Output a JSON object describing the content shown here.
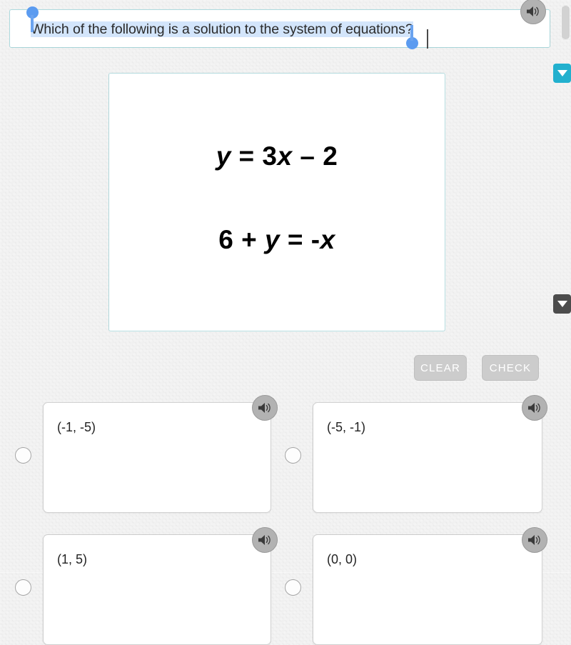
{
  "question": {
    "text": "Which of the following is a solution to the system of equations?",
    "speaker_icon": "speaker-icon"
  },
  "equation_panel": {
    "lines": [
      {
        "html": "<i>y</i> = 3<i>x</i> – 2",
        "plain": "y = 3x – 2"
      },
      {
        "html": "6 + <i>y</i> = -<i>x</i>",
        "plain": "6 + y = -x"
      }
    ]
  },
  "actions": {
    "clear_label": "CLEAR",
    "check_label": "CHECK"
  },
  "options": [
    {
      "label": "(-1, -5)",
      "selected": false,
      "speaker_icon": "speaker-icon"
    },
    {
      "label": "(-5, -1)",
      "selected": false,
      "speaker_icon": "speaker-icon"
    },
    {
      "label": "(1, 5)",
      "selected": false,
      "speaker_icon": "speaker-icon"
    },
    {
      "label": "(0, 0)",
      "selected": false,
      "speaker_icon": "speaker-icon"
    }
  ],
  "edge_widgets": {
    "cyan_tab_icon": "chevron-down-icon",
    "dark_tab_icon": "chevron-down-icon",
    "scrollbar": "vertical-scrollbar"
  },
  "colors": {
    "page_background": "#e9e9e9",
    "prompt_border": "#a9d6da",
    "panel_border": "#b5dcdf",
    "selection_highlight": "#d3e5fb",
    "selection_handle": "#5b9bf0",
    "button_fill": "#cccccc",
    "speaker_fill": "#b2b2b2",
    "cyan_tab": "#22b0ce",
    "dark_tab": "#4c4c4c"
  }
}
